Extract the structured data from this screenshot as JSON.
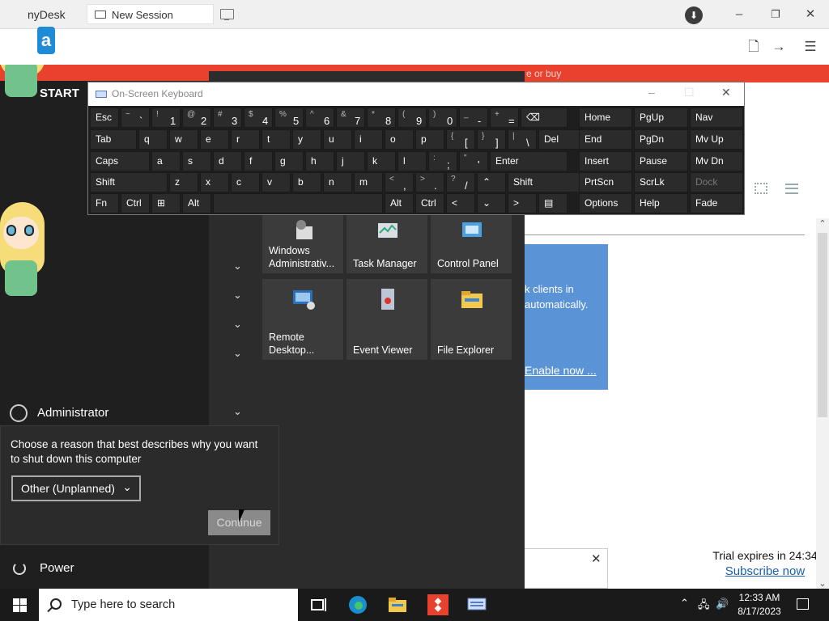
{
  "anydesk": {
    "app_title": "AnyDesk",
    "app_title_visible": "nyDesk",
    "session_tab": "New Session",
    "window_controls": {
      "minimize": "–",
      "restore": "❐",
      "close": "✕"
    },
    "toolbar_icons": [
      "file-transfer-icon",
      "arrow-right-icon",
      "menu-icon"
    ]
  },
  "remote": {
    "banner_text": "e or buy",
    "card_lines": [
      "k clients in",
      "automatically."
    ],
    "card_link": "Enable now ...",
    "trial_text": "Trial expires in 24:34",
    "trial_link": "Subscribe now"
  },
  "start_menu": {
    "header": "START",
    "group_chevrons": 5,
    "tiles": [
      {
        "label": "Windows Administrativ...",
        "icon": "admin-tools-icon"
      },
      {
        "label": "Task Manager",
        "icon": "task-manager-icon"
      },
      {
        "label": "Control Panel",
        "icon": "control-panel-icon"
      },
      {
        "label": "Remote Desktop...",
        "icon": "remote-desktop-icon"
      },
      {
        "label": "Event Viewer",
        "icon": "event-viewer-icon"
      },
      {
        "label": "File Explorer",
        "icon": "folder-icon"
      }
    ],
    "user": "Administrator",
    "power": "Power"
  },
  "shutdown_dialog": {
    "prompt": "Choose a reason that best describes why you want to shut down this computer",
    "selected_reason": "Other (Unplanned)",
    "continue_label": "Continue"
  },
  "osk": {
    "title": "On-Screen Keyboard",
    "rows": [
      [
        {
          "l": "Esc"
        },
        {
          "s": "~",
          "m": "`"
        },
        {
          "s": "!",
          "m": "1"
        },
        {
          "s": "@",
          "m": "2"
        },
        {
          "s": "#",
          "m": "3"
        },
        {
          "s": "$",
          "m": "4"
        },
        {
          "s": "%",
          "m": "5"
        },
        {
          "s": "^",
          "m": "6"
        },
        {
          "s": "&",
          "m": "7"
        },
        {
          "s": "*",
          "m": "8"
        },
        {
          "s": "(",
          "m": "9"
        },
        {
          "s": ")",
          "m": "0"
        },
        {
          "s": "_",
          "m": "-"
        },
        {
          "s": "+",
          "m": "="
        },
        {
          "l": "⌫"
        }
      ],
      [
        {
          "l": "Tab"
        },
        {
          "l": "q"
        },
        {
          "l": "w"
        },
        {
          "l": "e"
        },
        {
          "l": "r"
        },
        {
          "l": "t"
        },
        {
          "l": "y"
        },
        {
          "l": "u"
        },
        {
          "l": "i"
        },
        {
          "l": "o"
        },
        {
          "l": "p"
        },
        {
          "s": "{",
          "m": "["
        },
        {
          "s": "}",
          "m": "]"
        },
        {
          "s": "|",
          "m": "\\"
        },
        {
          "l": "Del"
        }
      ],
      [
        {
          "l": "Caps"
        },
        {
          "l": "a"
        },
        {
          "l": "s"
        },
        {
          "l": "d"
        },
        {
          "l": "f"
        },
        {
          "l": "g"
        },
        {
          "l": "h"
        },
        {
          "l": "j"
        },
        {
          "l": "k"
        },
        {
          "l": "l"
        },
        {
          "s": ":",
          "m": ";"
        },
        {
          "s": "\"",
          "m": "'"
        },
        {
          "l": "Enter"
        }
      ],
      [
        {
          "l": "Shift"
        },
        {
          "l": "z"
        },
        {
          "l": "x"
        },
        {
          "l": "c"
        },
        {
          "l": "v"
        },
        {
          "l": "b"
        },
        {
          "l": "n"
        },
        {
          "l": "m"
        },
        {
          "s": "<",
          "m": ","
        },
        {
          "s": ">",
          "m": "."
        },
        {
          "s": "?",
          "m": "/"
        },
        {
          "l": "⌃"
        },
        {
          "l": "Shift"
        }
      ],
      [
        {
          "l": "Fn"
        },
        {
          "l": "Ctrl"
        },
        {
          "l": "⊞"
        },
        {
          "l": "Alt"
        },
        {
          "l": ""
        },
        {
          "l": "Alt"
        },
        {
          "l": "Ctrl"
        },
        {
          "l": "<"
        },
        {
          "l": "⌄"
        },
        {
          "l": ">"
        },
        {
          "l": "▤"
        }
      ]
    ],
    "nav": [
      [
        "Home",
        "PgUp",
        "Nav"
      ],
      [
        "End",
        "PgDn",
        "Mv Up"
      ],
      [
        "Insert",
        "Pause",
        "Mv Dn"
      ],
      [
        "PrtScn",
        "ScrLk",
        "Dock"
      ],
      [
        "Options",
        "Help",
        "Fade"
      ]
    ]
  },
  "taskbar": {
    "search_placeholder": "Type here to search",
    "apps": [
      "task-view-icon",
      "edge-icon",
      "file-explorer-icon",
      "anydesk-icon",
      "osk-icon"
    ],
    "time": "12:33 AM",
    "date": "8/17/2023"
  }
}
